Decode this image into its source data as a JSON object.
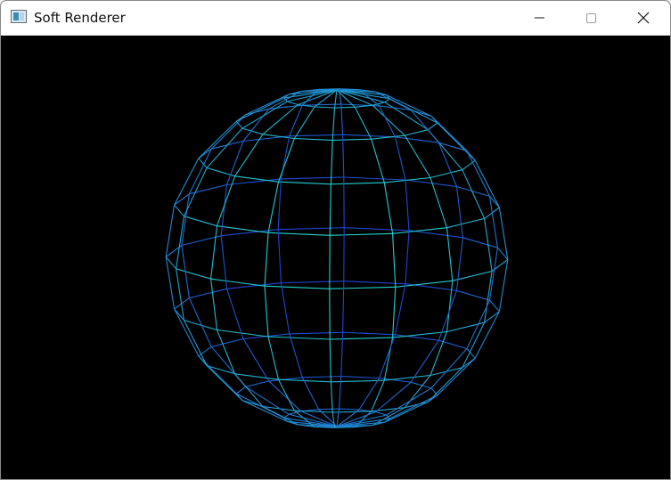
{
  "window": {
    "title": "Soft Renderer",
    "controls": {
      "minimize": "minimize",
      "maximize": "maximize",
      "close": "close"
    }
  },
  "render": {
    "type": "wireframe-sphere",
    "background": "#000000",
    "stroke_near": "#22d8d0",
    "stroke_far": "#1f3fd0"
  }
}
